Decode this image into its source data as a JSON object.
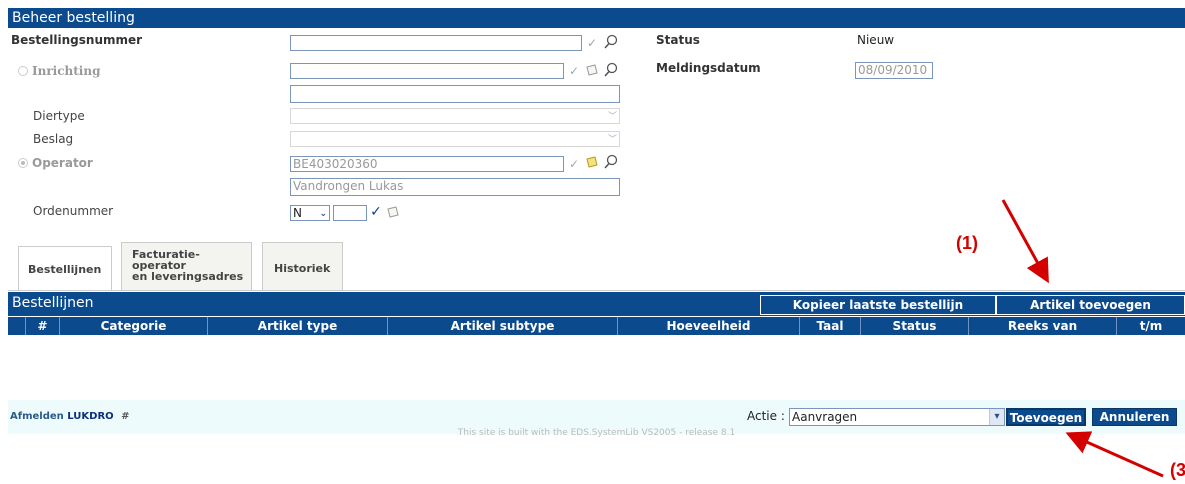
{
  "page_title": "Beheer bestelling",
  "form": {
    "bestellingsnummer_label": "Bestellingsnummer",
    "bestellingsnummer_value": "",
    "inrichting_label": "Inrichting",
    "inrichting_value": "",
    "inrichting_name": "",
    "diertype_label": "Diertype",
    "beslag_label": "Beslag",
    "operator_label": "Operator",
    "operator_value": "BE403020360",
    "operator_name": "Vandrongen Lukas",
    "ordenummer_label": "Ordenummer",
    "ordenummer_select": "N",
    "ordenummer_value": "",
    "status_label": "Status",
    "status_value": "Nieuw",
    "meldingsdatum_label": "Meldingsdatum",
    "meldingsdatum_value": "08/09/2010"
  },
  "tabs": [
    {
      "label": "Bestellijnen",
      "active": true
    },
    {
      "label": "Facturatie-\noperator\nen leveringsadres",
      "active": false
    },
    {
      "label": "Historiek",
      "active": false
    }
  ],
  "grid": {
    "title": "Bestellijnen",
    "copy_button": "Kopieer laatste bestellijn",
    "add_button": "Artikel toevoegen",
    "columns": [
      "#",
      "Categorie",
      "Artikel type",
      "Artikel subtype",
      "Hoeveelheid",
      "Taal",
      "Status",
      "Reeks van",
      "t/m"
    ]
  },
  "footer": {
    "logout_label": "Afmelden",
    "user": "LUKDRO",
    "hash": "#",
    "actie_label": "Actie :",
    "actie_value": "Aanvragen",
    "add_button": "Toevoegen",
    "cancel_button": "Annuleren",
    "built_with": "This site is built with the EDS.SystemLib VS2005 - release 8.1"
  },
  "annotations": {
    "marker_1": "(1)",
    "marker_3": "(3"
  },
  "colors": {
    "header_blue": "#0b4a8c",
    "footer_bg": "#eefbfc",
    "annotation_red": "#d40000"
  }
}
